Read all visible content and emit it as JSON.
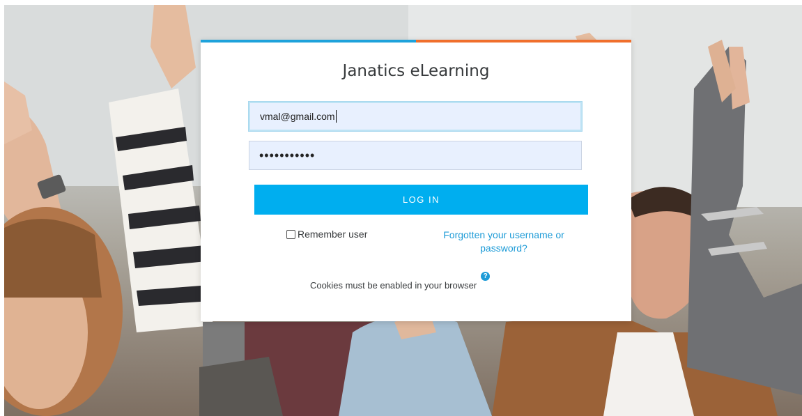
{
  "site": {
    "title": "Janatics eLearning"
  },
  "login": {
    "username_value": "vmal@gmail.com",
    "password_masked": "•••••••••••",
    "login_button": "LOG IN",
    "remember_label": "Remember user",
    "forgot_link": "Forgotten your username or password?",
    "cookies_notice": "Cookies must be enabled in your browser",
    "help_icon": "question-circle-icon"
  },
  "colors": {
    "accent_blue": "#1ea2db",
    "accent_orange": "#f06f2c",
    "button": "#00aeef",
    "link": "#1d9bd7",
    "input_bg": "#e8f0fe"
  }
}
